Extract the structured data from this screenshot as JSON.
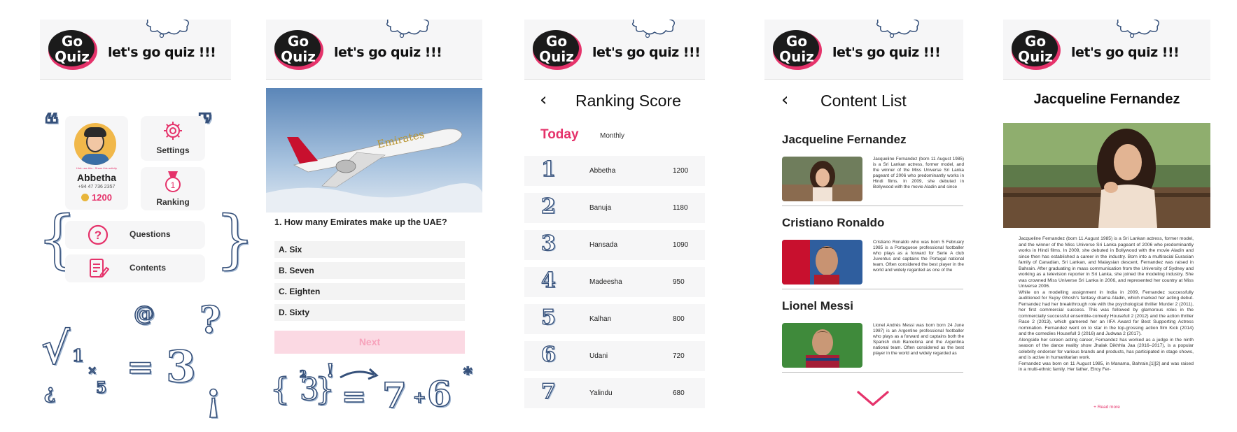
{
  "header": {
    "logo_top": "Go",
    "logo_bottom": "Quiz",
    "tagline": "let's go quiz !!!"
  },
  "home": {
    "profile": {
      "small_text": "Hint: use this · Share this activity",
      "name": "Abbetha",
      "phone": "+94 47 736 2357",
      "coins": "1200"
    },
    "settings_label": "Settings",
    "ranking_label": "Ranking",
    "ranking_badge": "1",
    "questions_label": "Questions",
    "contents_label": "Contents",
    "deco": {
      "radical": "√",
      "one": "1",
      "times": "×",
      "five": "5",
      "equals": "=",
      "three": "3",
      "at": "@",
      "question": "?",
      "inv_question": "¿",
      "inv_exclaim": "¡",
      "quote_open": "❝",
      "quote_close": "❞",
      "brace_open": "{",
      "brace_close": "}"
    }
  },
  "quiz": {
    "plane_livery": "Emirates",
    "question": "1. How many Emirates make up the UAE?",
    "options": [
      "A. Six",
      "B. Seven",
      "C. Eighten",
      "D. Sixty"
    ],
    "next_label": "Next",
    "deco": {
      "expr_left": "{ 3",
      "exp": "2",
      "brace": "}",
      "bang": "!",
      "equals": "=",
      "seven": "7",
      "plus": "+",
      "six": "6",
      "star": "*"
    }
  },
  "ranking": {
    "title": "Ranking Score",
    "back": "‹",
    "tab_today": "Today",
    "tab_monthly": "Monthly",
    "rows": [
      {
        "rank": "1",
        "name": "Abbetha",
        "score": "1200"
      },
      {
        "rank": "2",
        "name": "Banuja",
        "score": "1180"
      },
      {
        "rank": "3",
        "name": "Hansada",
        "score": "1090"
      },
      {
        "rank": "4",
        "name": "Madeesha",
        "score": "950"
      },
      {
        "rank": "5",
        "name": "Kalhan",
        "score": "800"
      },
      {
        "rank": "6",
        "name": "Udani",
        "score": "720"
      },
      {
        "rank": "7",
        "name": "Yalindu",
        "score": "680"
      }
    ]
  },
  "contents": {
    "title": "Content List",
    "back": "‹",
    "items": [
      {
        "title": "Jacqueline Fernandez",
        "text": "Jacqueline Fernandez (born 11 August 1985) is a Sri Lankan actress, former model, and the winner of the Miss Universe Sri Lanka pageant of 2006 who predominantly works in Hindi films. In 2009, she debuted in Bollywood with the movie Aladin and since"
      },
      {
        "title": "Cristiano Ronaldo",
        "text": "Cristiano Ronaldo who was born 5 February 1985 is a Portuguese professional footballer who plays as a forward for Serie A club Juventus and captains the Portugal national team. Often considered the best player in the world and widely regarded as one of the"
      },
      {
        "title": "Lionel Messi",
        "text": "Lionel Andrés Messi was born born 24 June 1987) is an Argentine professional footballer who plays as a forward and captains both the Spanish club Barcelona and the Argentina national team. Often considered as the best player in the world and widely regarded as"
      }
    ]
  },
  "detail": {
    "title": "Jacqueline Fernandez",
    "body": "        Jacqueline Fernandez (born 11 August 1985) is a Sri Lankan actress, former model, and the winner of the Miss Universe Sri Lanka pageant of 2006 who predominantly works in Hindi films. In 2009, she debuted in Bollywood with the movie Aladin and since then has established a career in the industry. Born into a multiracial Eurasian family of Canadian, Sri Lankan, and Malaysian descent, Fernandez was raised in Bahrain. After graduating in mass communication from the University of Sydney and working as a television reporter in Sri Lanka, she joined the modeling industry. She was crowned Miss Universe Sri Lanka in 2006, and represented her country at Miss Universe 2006.\n        While on a modelling assignment in India in 2009, Fernandez successfully auditioned for Sujoy Ghosh's fantasy drama Aladin, which marked her acting debut. Fernandez had her breakthrough role with the psychological thriller Murder 2 (2011), her first commercial success. This was followed by glamorous roles in the commercially successful ensemble-comedy Housefull 2 (2012) and the action thriller Race 2 (2013), which garnered her an IIFA Award for Best Supporting Actress nomination. Fernandez went on to star in the top-grossing action film Kick (2014) and the comedies Housefull 3 (2016) and Judwaa 2 (2017).\nAlongside her screen acting career, Fernandez has worked as a judge in the ninth season of the dance reality show Jhalak Dikhhla Jaa (2016–2017), is a popular celebrity endorser for various brands and products, has participated in stage shows, and is active in humanitarian work.\n        Fernandez was born on 11 August 1985, in Manama, Bahrain,[1][2] and was raised in a multi-ethnic family. Her father, Elroy Fer-",
    "read_more": "+ Read more"
  },
  "colors": {
    "accent": "#e5336b",
    "card": "#f6f6f7",
    "next_disabled": "#fbd9e3",
    "outline": "#35507a"
  }
}
